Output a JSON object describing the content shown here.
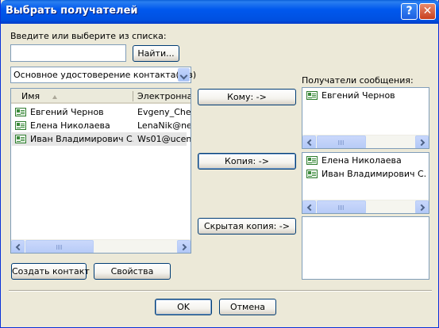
{
  "window": {
    "title": "Выбрать получателей"
  },
  "titlebar": {
    "help": "?",
    "close": "✕"
  },
  "search": {
    "label": "Введите или выберите из списка:",
    "value": "",
    "find_button": "Найти..."
  },
  "addressbook": {
    "selected": "Основное удостоверение контакта(-ов)"
  },
  "contacts": {
    "columns": [
      "Имя",
      "Электронная"
    ],
    "rows": [
      {
        "name": "Евгений Чернов",
        "email": "Evgeny_Chern"
      },
      {
        "name": "Елена Николаева",
        "email": "LenaNik@nev"
      },
      {
        "name": "Иван Владимирович С...",
        "email": "Ws01@ucentr"
      }
    ]
  },
  "recipients_label": "Получатели сообщения:",
  "buttons": {
    "to": "Кому: ->",
    "cc": "Копия: ->",
    "bcc": "Скрытая копия: ->",
    "new_contact": "Создать контакт",
    "properties": "Свойства",
    "ok": "OK",
    "cancel": "Отмена"
  },
  "to_list": [
    "Евгений Чернов"
  ],
  "cc_list": [
    "Елена Николаева",
    "Иван Владимирович С..."
  ],
  "bcc_list": [],
  "colors": {
    "title_bar": "#0058ee",
    "dialog_bg": "#ece9d8",
    "selection": "#e6e6e6"
  }
}
